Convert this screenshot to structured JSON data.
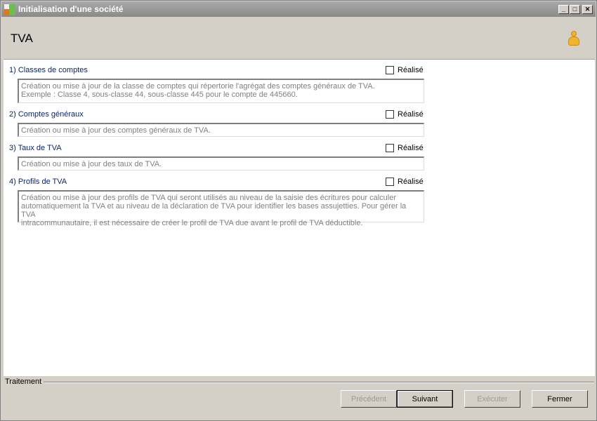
{
  "window": {
    "title": "Initialisation d'une société"
  },
  "header": {
    "title": "TVA"
  },
  "sections": [
    {
      "title": "1) Classes de comptes",
      "done_label": "Réalisé",
      "checked": false,
      "description": "Création ou mise à jour de la classe de comptes qui répertorie l'agrégat des comptes généraux de TVA.\nExemple : Classe 4, sous-classe 44, sous-classe 445 pour le compte de 445660."
    },
    {
      "title": "2) Comptes généraux",
      "done_label": "Réalisé",
      "checked": false,
      "description": "Création ou mise à jour des comptes généraux de TVA."
    },
    {
      "title": "3) Taux de TVA",
      "done_label": "Réalisé",
      "checked": false,
      "description": "Création ou mise à jour des taux de TVA."
    },
    {
      "title": "4) Profils de TVA",
      "done_label": "Réalisé",
      "checked": false,
      "description": "Création ou mise à jour des profils de TVA qui seront utilisés au niveau de la saisie des écritures pour calculer\nautomatiquement la TVA et au niveau de la déclaration de TVA pour identifier les bases assujetties. Pour gérer la TVA\nintracommunautaire, il est nécessaire de créer le profil de TVA due avant le profil de TVA déductible."
    }
  ],
  "footer": {
    "group_label": "Traitement",
    "buttons": {
      "previous": "Précédent",
      "next": "Suivant",
      "execute": "Exécuter",
      "close": "Fermer"
    }
  },
  "icons": {
    "app": "app-icon",
    "user": "person-icon",
    "minimize": "minimize-icon",
    "maximize": "maximize-icon",
    "close": "close-icon"
  },
  "colors": {
    "section_title": "#0a246a",
    "description_text": "#808080"
  }
}
